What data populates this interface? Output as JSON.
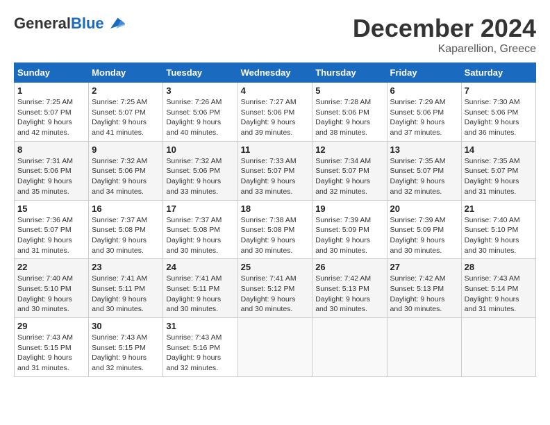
{
  "header": {
    "logo_general": "General",
    "logo_blue": "Blue",
    "month_title": "December 2024",
    "location": "Kaparellion, Greece"
  },
  "weekdays": [
    "Sunday",
    "Monday",
    "Tuesday",
    "Wednesday",
    "Thursday",
    "Friday",
    "Saturday"
  ],
  "weeks": [
    [
      {
        "day": "1",
        "sunrise": "7:25 AM",
        "sunset": "5:07 PM",
        "daylight": "9 hours and 42 minutes."
      },
      {
        "day": "2",
        "sunrise": "7:25 AM",
        "sunset": "5:07 PM",
        "daylight": "9 hours and 41 minutes."
      },
      {
        "day": "3",
        "sunrise": "7:26 AM",
        "sunset": "5:06 PM",
        "daylight": "9 hours and 40 minutes."
      },
      {
        "day": "4",
        "sunrise": "7:27 AM",
        "sunset": "5:06 PM",
        "daylight": "9 hours and 39 minutes."
      },
      {
        "day": "5",
        "sunrise": "7:28 AM",
        "sunset": "5:06 PM",
        "daylight": "9 hours and 38 minutes."
      },
      {
        "day": "6",
        "sunrise": "7:29 AM",
        "sunset": "5:06 PM",
        "daylight": "9 hours and 37 minutes."
      },
      {
        "day": "7",
        "sunrise": "7:30 AM",
        "sunset": "5:06 PM",
        "daylight": "9 hours and 36 minutes."
      }
    ],
    [
      {
        "day": "8",
        "sunrise": "7:31 AM",
        "sunset": "5:06 PM",
        "daylight": "9 hours and 35 minutes."
      },
      {
        "day": "9",
        "sunrise": "7:32 AM",
        "sunset": "5:06 PM",
        "daylight": "9 hours and 34 minutes."
      },
      {
        "day": "10",
        "sunrise": "7:32 AM",
        "sunset": "5:06 PM",
        "daylight": "9 hours and 33 minutes."
      },
      {
        "day": "11",
        "sunrise": "7:33 AM",
        "sunset": "5:07 PM",
        "daylight": "9 hours and 33 minutes."
      },
      {
        "day": "12",
        "sunrise": "7:34 AM",
        "sunset": "5:07 PM",
        "daylight": "9 hours and 32 minutes."
      },
      {
        "day": "13",
        "sunrise": "7:35 AM",
        "sunset": "5:07 PM",
        "daylight": "9 hours and 32 minutes."
      },
      {
        "day": "14",
        "sunrise": "7:35 AM",
        "sunset": "5:07 PM",
        "daylight": "9 hours and 31 minutes."
      }
    ],
    [
      {
        "day": "15",
        "sunrise": "7:36 AM",
        "sunset": "5:07 PM",
        "daylight": "9 hours and 31 minutes."
      },
      {
        "day": "16",
        "sunrise": "7:37 AM",
        "sunset": "5:08 PM",
        "daylight": "9 hours and 30 minutes."
      },
      {
        "day": "17",
        "sunrise": "7:37 AM",
        "sunset": "5:08 PM",
        "daylight": "9 hours and 30 minutes."
      },
      {
        "day": "18",
        "sunrise": "7:38 AM",
        "sunset": "5:08 PM",
        "daylight": "9 hours and 30 minutes."
      },
      {
        "day": "19",
        "sunrise": "7:39 AM",
        "sunset": "5:09 PM",
        "daylight": "9 hours and 30 minutes."
      },
      {
        "day": "20",
        "sunrise": "7:39 AM",
        "sunset": "5:09 PM",
        "daylight": "9 hours and 30 minutes."
      },
      {
        "day": "21",
        "sunrise": "7:40 AM",
        "sunset": "5:10 PM",
        "daylight": "9 hours and 30 minutes."
      }
    ],
    [
      {
        "day": "22",
        "sunrise": "7:40 AM",
        "sunset": "5:10 PM",
        "daylight": "9 hours and 30 minutes."
      },
      {
        "day": "23",
        "sunrise": "7:41 AM",
        "sunset": "5:11 PM",
        "daylight": "9 hours and 30 minutes."
      },
      {
        "day": "24",
        "sunrise": "7:41 AM",
        "sunset": "5:11 PM",
        "daylight": "9 hours and 30 minutes."
      },
      {
        "day": "25",
        "sunrise": "7:41 AM",
        "sunset": "5:12 PM",
        "daylight": "9 hours and 30 minutes."
      },
      {
        "day": "26",
        "sunrise": "7:42 AM",
        "sunset": "5:13 PM",
        "daylight": "9 hours and 30 minutes."
      },
      {
        "day": "27",
        "sunrise": "7:42 AM",
        "sunset": "5:13 PM",
        "daylight": "9 hours and 30 minutes."
      },
      {
        "day": "28",
        "sunrise": "7:43 AM",
        "sunset": "5:14 PM",
        "daylight": "9 hours and 31 minutes."
      }
    ],
    [
      {
        "day": "29",
        "sunrise": "7:43 AM",
        "sunset": "5:15 PM",
        "daylight": "9 hours and 31 minutes."
      },
      {
        "day": "30",
        "sunrise": "7:43 AM",
        "sunset": "5:15 PM",
        "daylight": "9 hours and 32 minutes."
      },
      {
        "day": "31",
        "sunrise": "7:43 AM",
        "sunset": "5:16 PM",
        "daylight": "9 hours and 32 minutes."
      },
      null,
      null,
      null,
      null
    ]
  ]
}
